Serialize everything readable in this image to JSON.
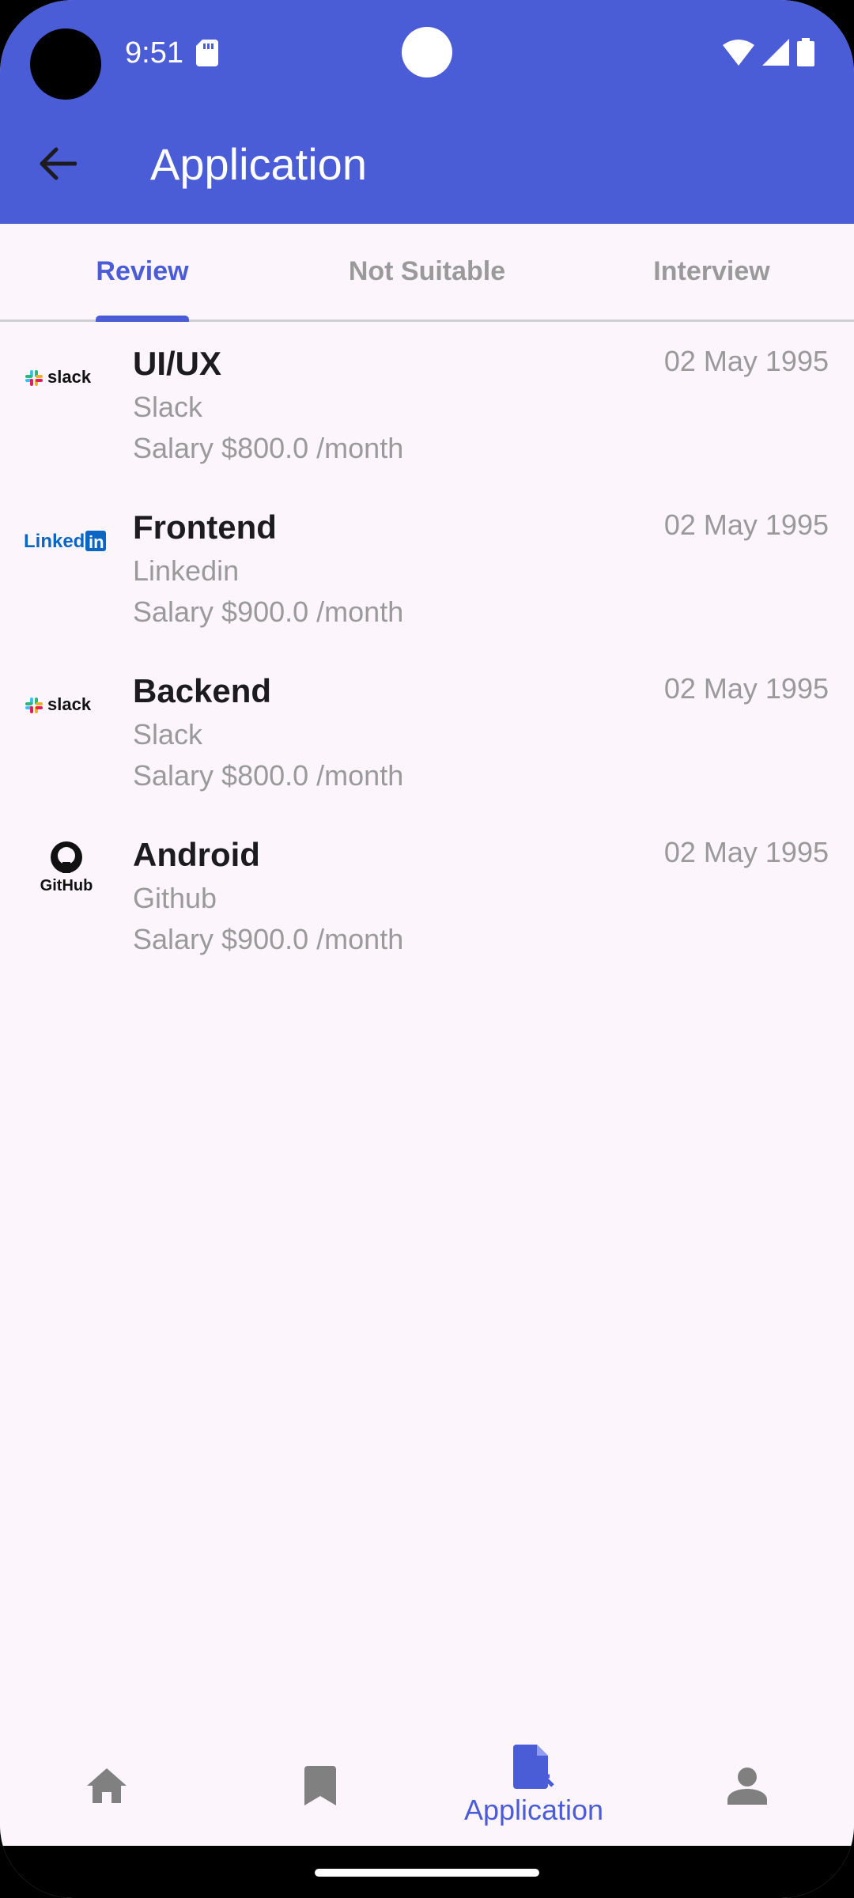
{
  "status_bar": {
    "time": "9:51"
  },
  "header": {
    "title": "Application"
  },
  "tabs": [
    {
      "label": "Review",
      "active": true
    },
    {
      "label": "Not Suitable",
      "active": false
    },
    {
      "label": "Interview",
      "active": false
    }
  ],
  "applications": [
    {
      "logo": "slack",
      "title": "UI/UX",
      "company": "Slack",
      "salary": "Salary $800.0 /month",
      "date": "02 May 1995"
    },
    {
      "logo": "linkedin",
      "title": "Frontend",
      "company": "Linkedin",
      "salary": "Salary $900.0 /month",
      "date": "02 May 1995"
    },
    {
      "logo": "slack",
      "title": "Backend",
      "company": "Slack",
      "salary": "Salary $800.0 /month",
      "date": "02 May 1995"
    },
    {
      "logo": "github",
      "title": "Android",
      "company": "Github",
      "salary": "Salary $900.0 /month",
      "date": "02 May 1995"
    }
  ],
  "bottom_nav": {
    "items": [
      {
        "icon": "home-icon",
        "label": ""
      },
      {
        "icon": "bookmark-icon",
        "label": ""
      },
      {
        "icon": "application-icon",
        "label": "Application"
      },
      {
        "icon": "profile-icon",
        "label": ""
      }
    ],
    "active_index": 2
  },
  "logo_text": {
    "slack": "slack",
    "linkedin": "Linked",
    "linkedin_in": "in",
    "github": "GitHub"
  },
  "colors": {
    "primary": "#4a5cd6",
    "background": "#fcf5fc",
    "muted": "#9a9a9a"
  }
}
